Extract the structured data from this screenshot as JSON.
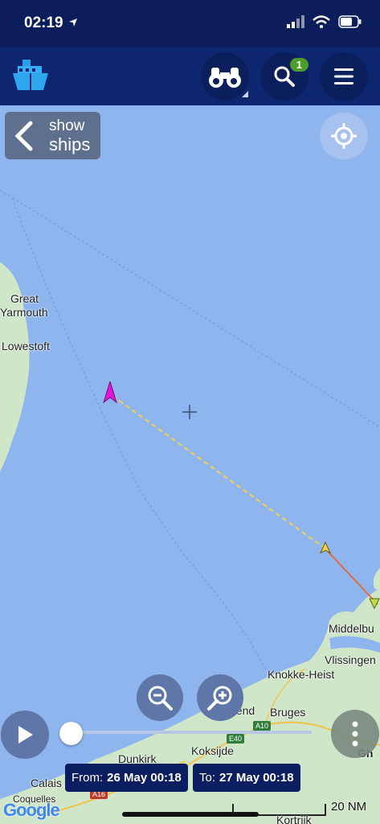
{
  "status": {
    "time": "02:19"
  },
  "header": {
    "logo_icon": "ship-logo-icon",
    "binoculars_icon": "binoculars-icon",
    "search_icon": "search-icon",
    "search_badge": "1",
    "menu_icon": "hamburger-menu-icon"
  },
  "show_ships": {
    "line1": "show",
    "line2": "ships"
  },
  "map": {
    "labels": {
      "great": "Great",
      "yarmouth": "Yarmouth",
      "lowestoft": "Lowestoft",
      "middelburg": "Middelbu",
      "vlissingen": "Vlissingen",
      "knokke": "Knokke-Heist",
      "ostend": "Ostend",
      "bruges": "Bruges",
      "koksijde": "Koksijde",
      "dunkirk": "Dunkirk",
      "calais": "Calais",
      "coquelles": "Coquelles",
      "gh": "Gh",
      "kortrijk": "Kortrijk",
      "a10": "A10",
      "e40": "E40",
      "a16": "A16"
    },
    "colors": {
      "sea": "#8fb5ef",
      "land": "#cfe6c8",
      "vessel": "#e016d8",
      "track": "#f2d24a"
    }
  },
  "controls": {
    "zoom_out_icon": "zoom-out-icon",
    "zoom_in_icon": "zoom-in-icon",
    "play_icon": "play-icon",
    "more_icon": "more-vertical-icon",
    "timeline_progress": 0.0
  },
  "date_range": {
    "from_label": "From:",
    "from_value": "26 May 00:18",
    "to_label": "To:",
    "to_value": "27 May 00:18"
  },
  "footer": {
    "google": "Google",
    "scale": "20 NM"
  }
}
